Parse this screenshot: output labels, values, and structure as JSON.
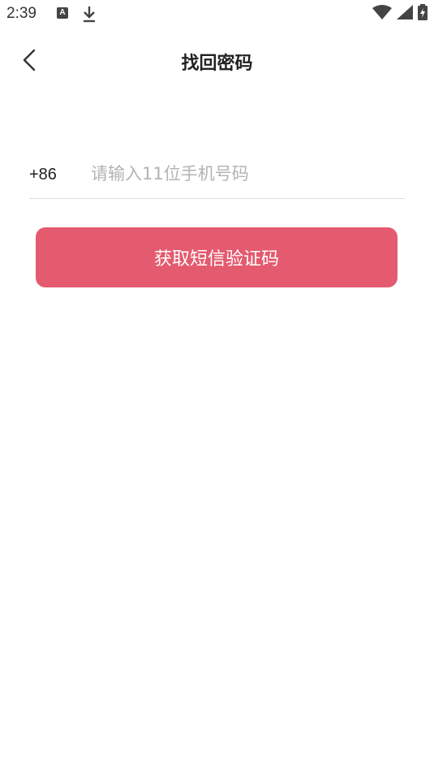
{
  "status_bar": {
    "time": "2:39",
    "notification_icon_letter": "A",
    "icons": [
      "a-notification-icon",
      "download-icon",
      "wifi-icon",
      "signal-icon",
      "battery-charging-icon"
    ]
  },
  "header": {
    "title": "找回密码",
    "back_icon": "chevron-left-icon"
  },
  "form": {
    "country_code": "+86",
    "phone_value": "",
    "phone_placeholder": "请输入11位手机号码",
    "submit_label": "获取短信验证码"
  },
  "colors": {
    "accent": "#e45a6e",
    "placeholder": "#b3b3b3",
    "divider": "#dddddd",
    "text": "#222222"
  }
}
